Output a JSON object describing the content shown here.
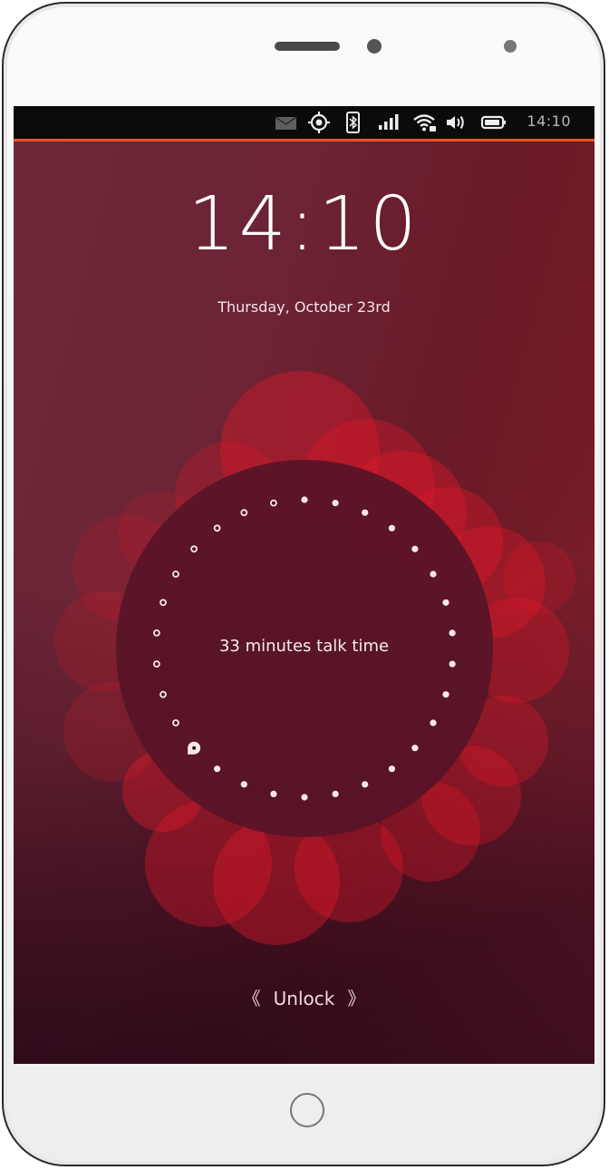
{
  "device": {
    "type": "smartphone"
  },
  "status_bar": {
    "time": "14:10",
    "icons": [
      "messages-icon",
      "location-icon",
      "bluetooth-icon",
      "cellular-signal-icon",
      "wifi-icon",
      "volume-icon",
      "battery-icon"
    ]
  },
  "lock_screen": {
    "clock": "14:10",
    "date": "Thursday, October 23rd",
    "infographic": {
      "label": "33 minutes talk time",
      "total_dots": 30,
      "filled_dots": 19,
      "marker_index": 19,
      "colors": {
        "circle": "#5a1428",
        "dot": "#f5e8ec",
        "petal": "#e0182a"
      }
    },
    "unlock": {
      "left_chevron": "《",
      "label": "Unlock",
      "right_chevron": "》"
    }
  },
  "colors": {
    "accent": "#e95420",
    "status_bar_bg": "#0b0b0b"
  }
}
